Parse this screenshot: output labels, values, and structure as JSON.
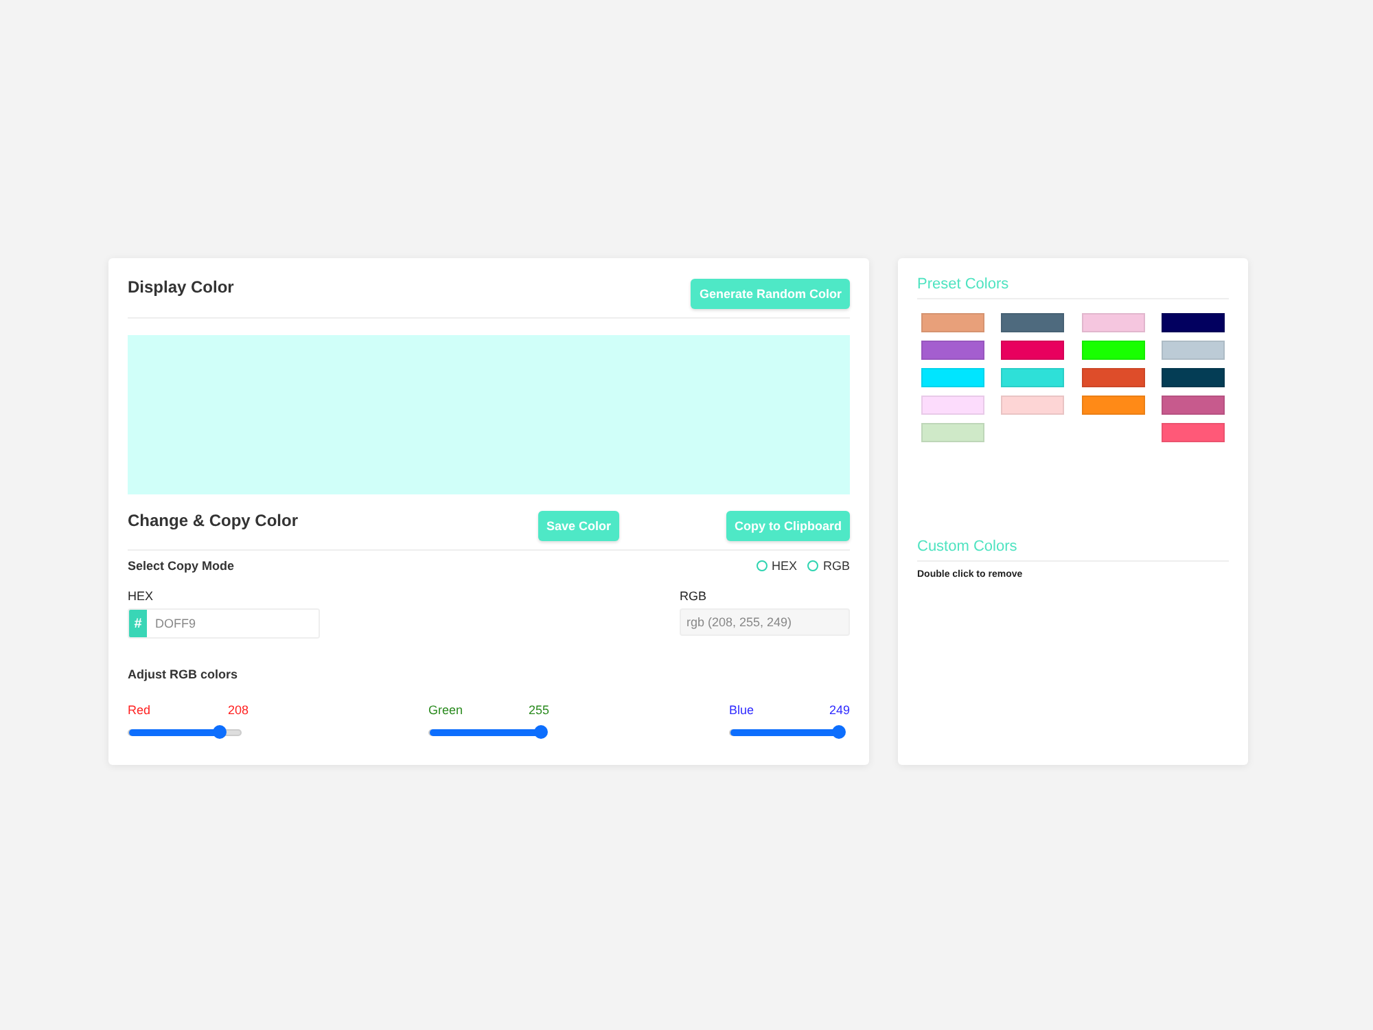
{
  "display": {
    "title": "Display Color",
    "random_button": "Generate Random Color",
    "color": "#d0fff9"
  },
  "change": {
    "title": "Change & Copy Color",
    "save_button": "Save Color",
    "copy_button": "Copy to Clipboard"
  },
  "copy_mode": {
    "label": "Select Copy Mode",
    "options": [
      {
        "label": "HEX",
        "selected": false
      },
      {
        "label": "RGB",
        "selected": false
      }
    ]
  },
  "hex_field": {
    "label": "HEX",
    "prefix": "#",
    "value": "DOFF9"
  },
  "rgb_field": {
    "label": "RGB",
    "value": "rgb (208, 255, 249)"
  },
  "adjust": {
    "title": "Adjust RGB colors",
    "sliders": [
      {
        "name": "Red",
        "reading": "208",
        "color": "#ff2020",
        "level": 0.816
      },
      {
        "name": "Green",
        "reading": "255",
        "color": "#2a8a1e",
        "level": 1
      },
      {
        "name": "Blue",
        "reading": "249",
        "color": "#2f2bff",
        "level": 0.976
      }
    ]
  },
  "preset": {
    "title": "Preset Colors",
    "columns": [
      {
        "swatches": [
          {
            "color": "#e8a07a"
          },
          {
            "color": "#a45ecf"
          },
          {
            "color": "#00e5ff"
          },
          {
            "color": "#fcdcfc"
          },
          {
            "color": "#cfe9c8"
          }
        ]
      },
      {
        "swatches": [
          {
            "color": "#4e6a7e"
          },
          {
            "color": "#e8005e"
          },
          {
            "color": "#2ee0d8"
          },
          {
            "color": "#fdd5d5"
          }
        ]
      },
      {
        "swatches": [
          {
            "color": "#f5c6df"
          },
          {
            "color": "#18ff00"
          },
          {
            "color": "#de4d2a"
          },
          {
            "color": "#ff8a17"
          }
        ]
      },
      {
        "swatches": [
          {
            "color": "#02005f"
          },
          {
            "color": "#bccbd6"
          },
          {
            "color": "#043d55"
          },
          {
            "color": "#c75a8d"
          },
          {
            "color": "#ff5978"
          }
        ]
      }
    ]
  },
  "custom": {
    "title": "Custom Colors",
    "hint": "Double click to remove"
  }
}
